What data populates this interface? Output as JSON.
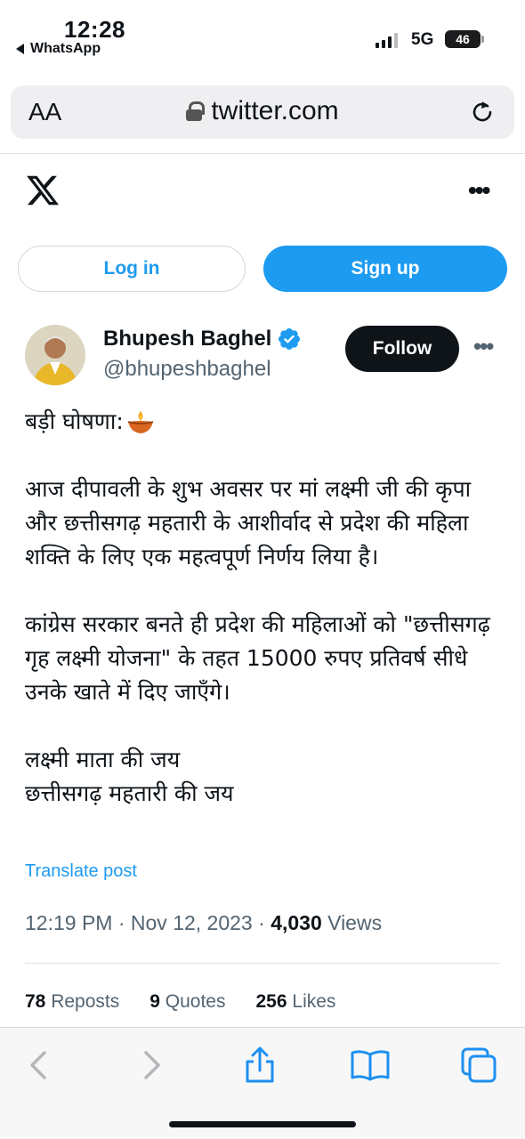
{
  "status": {
    "time": "12:28",
    "back_app": "WhatsApp",
    "network": "5G",
    "battery": "46"
  },
  "browser": {
    "text_size_label": "AA",
    "url": "twitter.com"
  },
  "header": {
    "login_label": "Log in",
    "signup_label": "Sign up"
  },
  "tweet": {
    "author_name": "Bhupesh Baghel",
    "handle": "@bhupeshbaghel",
    "follow_label": "Follow",
    "line_heading": "बड़ी घोषणा:",
    "paragraph1": "आज दीपावली के शुभ अवसर पर मां लक्ष्मी जी की कृपा और छत्तीसगढ़ महतारी के आशीर्वाद से प्रदेश की महिला शक्ति के लिए एक महत्वपूर्ण निर्णय लिया है।",
    "paragraph2": "कांग्रेस सरकार बनते ही प्रदेश की महिलाओं को \"छत्तीसगढ़ गृह लक्ष्मी योजना\" के तहत 15000 रुपए प्रतिवर्ष सीधे उनके खाते में दिए जाएँगे।",
    "closing1": "लक्ष्मी माता की जय",
    "closing2": "छत्तीसगढ़ महतारी की जय",
    "translate_label": "Translate post",
    "time": "12:19 PM",
    "date": "Nov 12, 2023",
    "views_count": "4,030",
    "views_label": "Views",
    "reposts_count": "78",
    "reposts_label": "Reposts",
    "quotes_count": "9",
    "quotes_label": "Quotes",
    "likes_count": "256",
    "likes_label": "Likes"
  },
  "colors": {
    "accent": "#1d9bf0",
    "text": "#0f1419",
    "muted": "#536471"
  }
}
